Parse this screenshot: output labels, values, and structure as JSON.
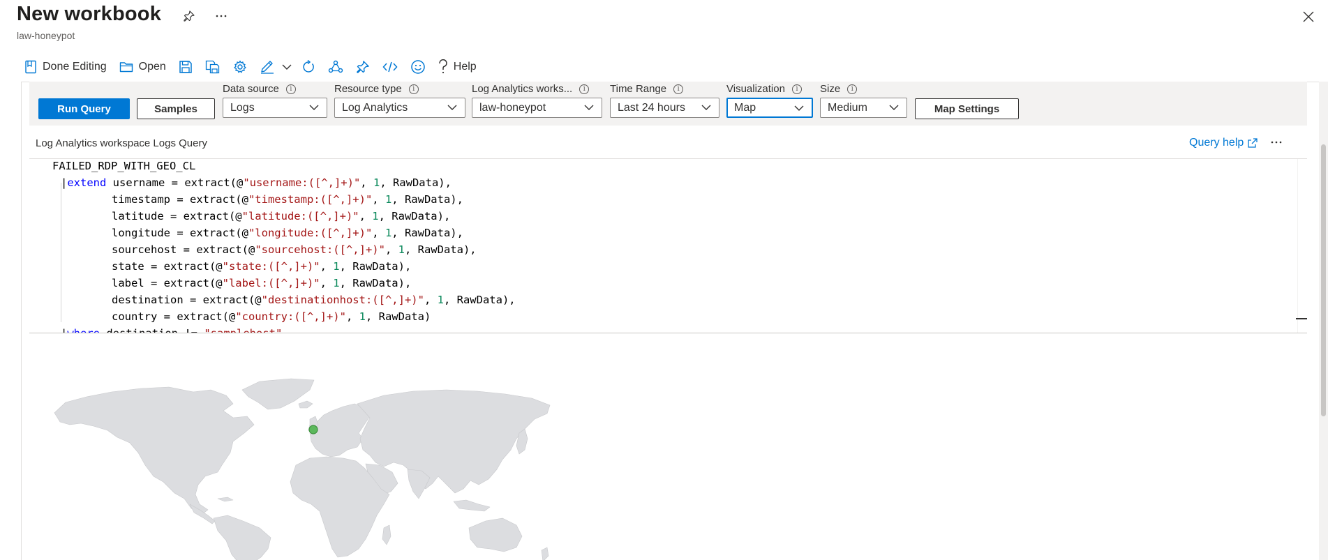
{
  "header": {
    "title": "New workbook",
    "subtitle": "law-honeypot"
  },
  "toolbar": {
    "done_editing": "Done Editing",
    "open": "Open",
    "help": "Help"
  },
  "query_settings": {
    "run_query": "Run Query",
    "samples": "Samples",
    "map_settings": "Map Settings",
    "data_source": {
      "label": "Data source",
      "value": "Logs"
    },
    "resource_type": {
      "label": "Resource type",
      "value": "Log Analytics"
    },
    "workspace": {
      "label": "Log Analytics works...",
      "value": "law-honeypot"
    },
    "time_range": {
      "label": "Time Range",
      "value": "Last 24 hours"
    },
    "visualization": {
      "label": "Visualization",
      "value": "Map"
    },
    "size": {
      "label": "Size",
      "value": "Medium"
    }
  },
  "query": {
    "header_label": "Log Analytics workspace Logs Query",
    "help_link": "Query help",
    "lines": [
      "FAILED_RDP_WITH_GEO_CL",
      "| extend username = extract(@\"username:([^,]+)\", 1, RawData),",
      "         timestamp = extract(@\"timestamp:([^,]+)\", 1, RawData),",
      "         latitude = extract(@\"latitude:([^,]+)\", 1, RawData),",
      "         longitude = extract(@\"longitude:([^,]+)\", 1, RawData),",
      "         sourcehost = extract(@\"sourcehost:([^,]+)\", 1, RawData),",
      "         state = extract(@\"state:([^,]+)\", 1, RawData),",
      "         label = extract(@\"label:([^,]+)\", 1, RawData),",
      "         destination = extract(@\"destinationhost:([^,]+)\", 1, RawData),",
      "         country = extract(@\"country:([^,]+)\", 1, RawData)",
      "| where destination != \"samplehost\""
    ]
  },
  "colors": {
    "accent": "#0078d4",
    "map_land": "#dcdde0",
    "map_marker": "#5cb85c"
  }
}
